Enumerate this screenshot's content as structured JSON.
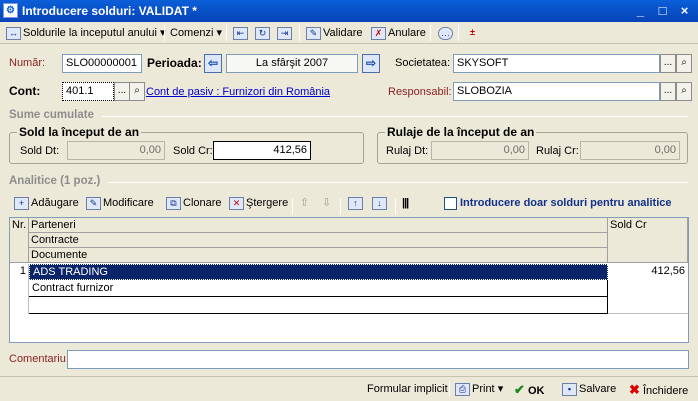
{
  "window": {
    "title": "Introducere solduri: VALIDAT *",
    "minimize_glyph": "_",
    "maximize_glyph": "□",
    "close_glyph": "×"
  },
  "toolbar": {
    "solduri_label": "Soldurile la inceputul anului",
    "comenzi_label": "Comenzi",
    "validare_label": "Validare",
    "anulare_label": "Anulare"
  },
  "form": {
    "numar_label": "Număr:",
    "numar_value": "SLO00000001",
    "perioada_label": "Perioada:",
    "perioada_value": "La sfârşit 2007",
    "societatea_label": "Societatea:",
    "societatea_value": "SKYSOFT",
    "cont_label": "Cont:",
    "cont_value": "401.1",
    "cont_link": "Cont de pasiv : Furnizori din România",
    "responsabil_label": "Responsabil:",
    "responsabil_value": "SLOBOZIA",
    "lookup_btn": "..."
  },
  "sume": {
    "section_title": "Sume cumulate",
    "sold_group_title": "Sold la început de an",
    "sold_dt_label": "Sold Dt:",
    "sold_dt_value": "0,00",
    "sold_cr_label": "Sold Cr:",
    "sold_cr_value": "412,56",
    "rulaje_group_title": "Rulaje de la început de an",
    "rulaj_dt_label": "Rulaj Dt:",
    "rulaj_dt_value": "0,00",
    "rulaj_cr_label": "Rulaj Cr:",
    "rulaj_cr_value": "0,00"
  },
  "analitice": {
    "section_title": "Analitice (1 poz.)",
    "adaugare_label": "Adăugare",
    "modificare_label": "Modificare",
    "clonare_label": "Clonare",
    "stergere_label": "Ştergere",
    "checkbox_label": "Introducere doar solduri pentru analitice",
    "columns": {
      "nr": "Nr.",
      "parteneri": "Parteneri",
      "contracte": "Contracte",
      "documente": "Documente",
      "sold_cr": "Sold Cr"
    },
    "rows": [
      {
        "nr": "1",
        "partener": "ADS TRADING",
        "contract": "Contract furnizor",
        "document": "",
        "sold_cr": "412,56"
      }
    ]
  },
  "comentariu_label": "Comentariu:",
  "comentariu_value": "",
  "footer": {
    "formular_label": "Formular implicit",
    "print_label": "Print",
    "ok_label": "OK",
    "salvare_label": "Salvare",
    "inchidere_label": "Închidere"
  },
  "colors": {
    "title_bar": "#0a5fd8",
    "selected_row": "#0a246a",
    "label_brown": "#8b2323",
    "link_blue": "#0000cc"
  }
}
